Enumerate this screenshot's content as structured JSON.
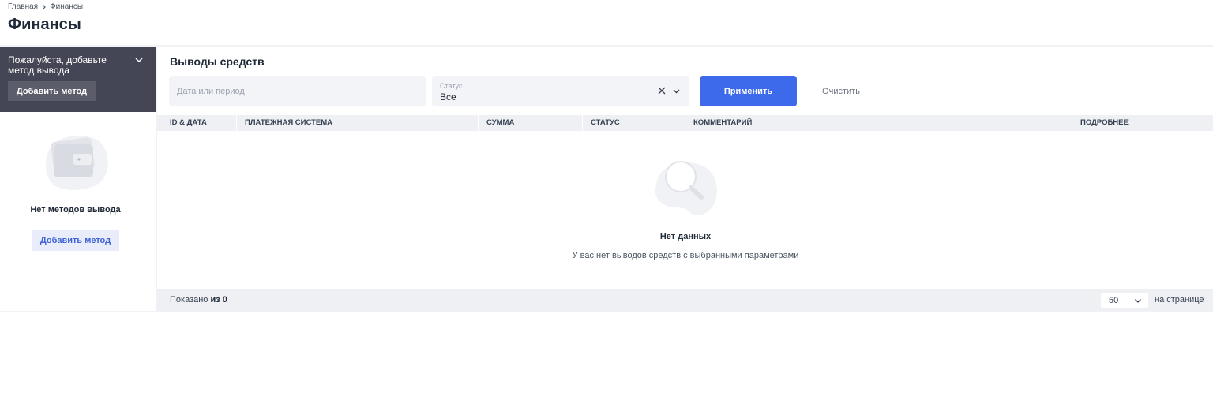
{
  "breadcrumb": {
    "items": [
      "Главная",
      "Финансы"
    ]
  },
  "page": {
    "title": "Финансы"
  },
  "left_panel": {
    "prompt_text": "Пожалуйста, добавьте метод вывода",
    "prompt_button": "Добавить метод",
    "empty_text": "Нет методов вывода",
    "add_button": "Добавить метод"
  },
  "withdrawals": {
    "title": "Выводы средств",
    "filters": {
      "date_placeholder": "Дата или период",
      "status_label": "Статус",
      "status_value": "Все",
      "apply_label": "Применить",
      "clear_label": "Очистить"
    },
    "table": {
      "columns": [
        "ID & ДАТА",
        "ПЛАТЕЖНАЯ СИСТЕМА",
        "СУММА",
        "СТАТУС",
        "КОММЕНТАРИЙ",
        "ПОДРОБНЕЕ"
      ]
    },
    "empty": {
      "title": "Нет данных",
      "subtitle": "У вас нет выводов средств с выбранными параметрами"
    },
    "footer": {
      "shown_prefix": "Показано",
      "shown_count": "из 0",
      "per_page_value": "50",
      "per_page_label": "на странице"
    }
  },
  "colors": {
    "accent": "#3d6aea",
    "dark_card": "#454655",
    "light_button": "#e8ecfb"
  },
  "icons": [
    "chevron-right-icon",
    "chevron-down-icon",
    "wallet-icon",
    "close-icon",
    "magnifier-icon"
  ]
}
